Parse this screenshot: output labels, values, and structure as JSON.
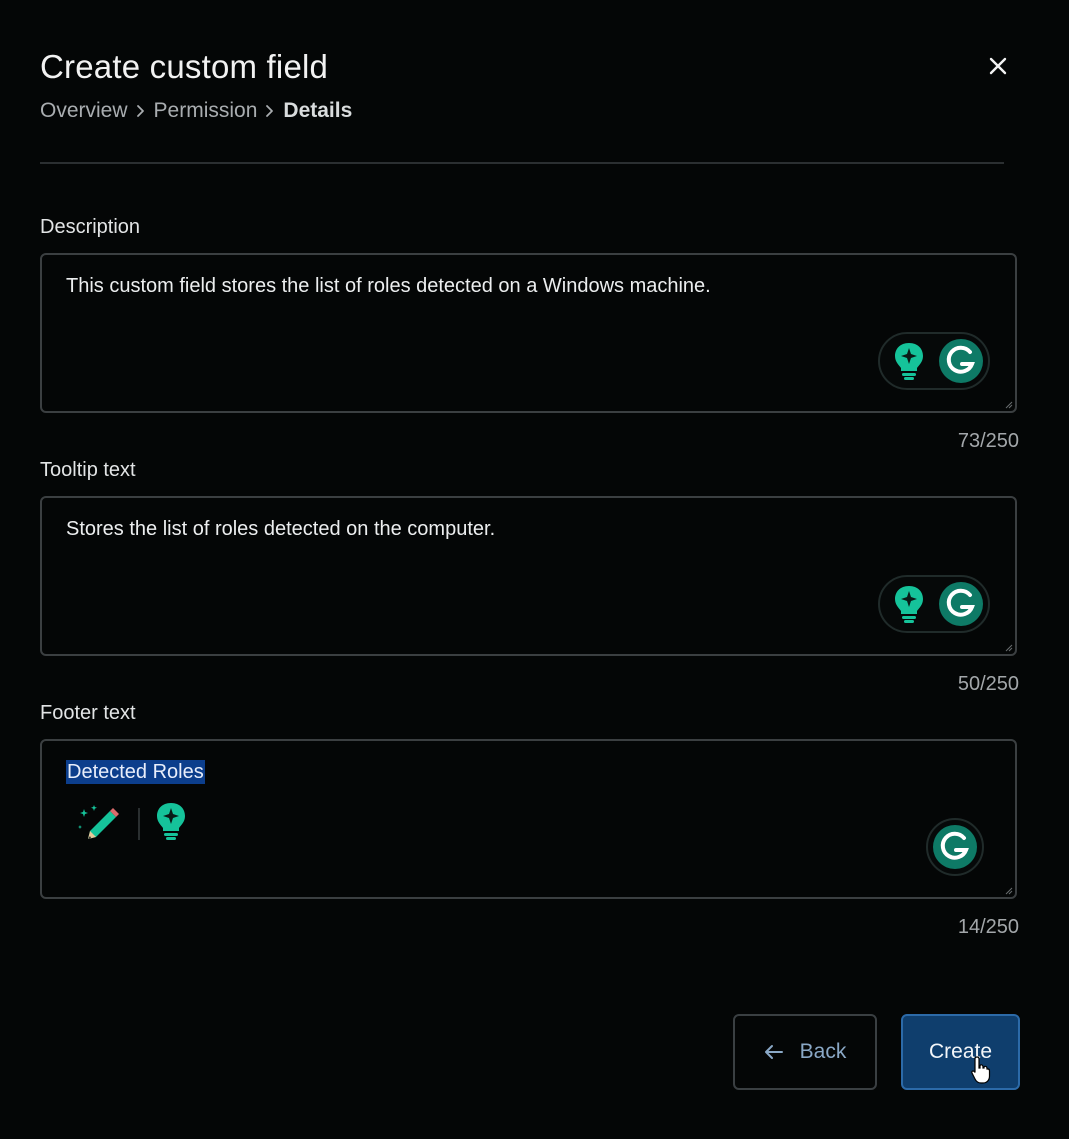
{
  "dialog": {
    "title": "Create custom field",
    "close_icon": "close-icon"
  },
  "breadcrumb": {
    "items": [
      "Overview",
      "Permission",
      "Details"
    ],
    "separator_icon": "chevron-right-icon"
  },
  "fields": {
    "description": {
      "label": "Description",
      "value": "This custom field stores the list of roles detected on a Windows machine.",
      "counter": "73/250"
    },
    "tooltip": {
      "label": "Tooltip text",
      "value": "Stores the list of roles detected on the computer.",
      "counter": "50/250"
    },
    "footer": {
      "label": "Footer text",
      "value": "Detected Roles",
      "counter": "14/250"
    }
  },
  "grammarly": {
    "bulb_icon": "lightbulb-sparkle-icon",
    "logo_icon": "grammarly-g-icon",
    "pencil_icon": "magic-pencil-icon",
    "brand_color": "#15c39a"
  },
  "buttons": {
    "back_label": "Back",
    "back_icon": "arrow-left-icon",
    "create_label": "Create"
  },
  "colors": {
    "background": "#040606",
    "selection": "#0c3e8c",
    "primary_button": "#0f3e6d"
  }
}
